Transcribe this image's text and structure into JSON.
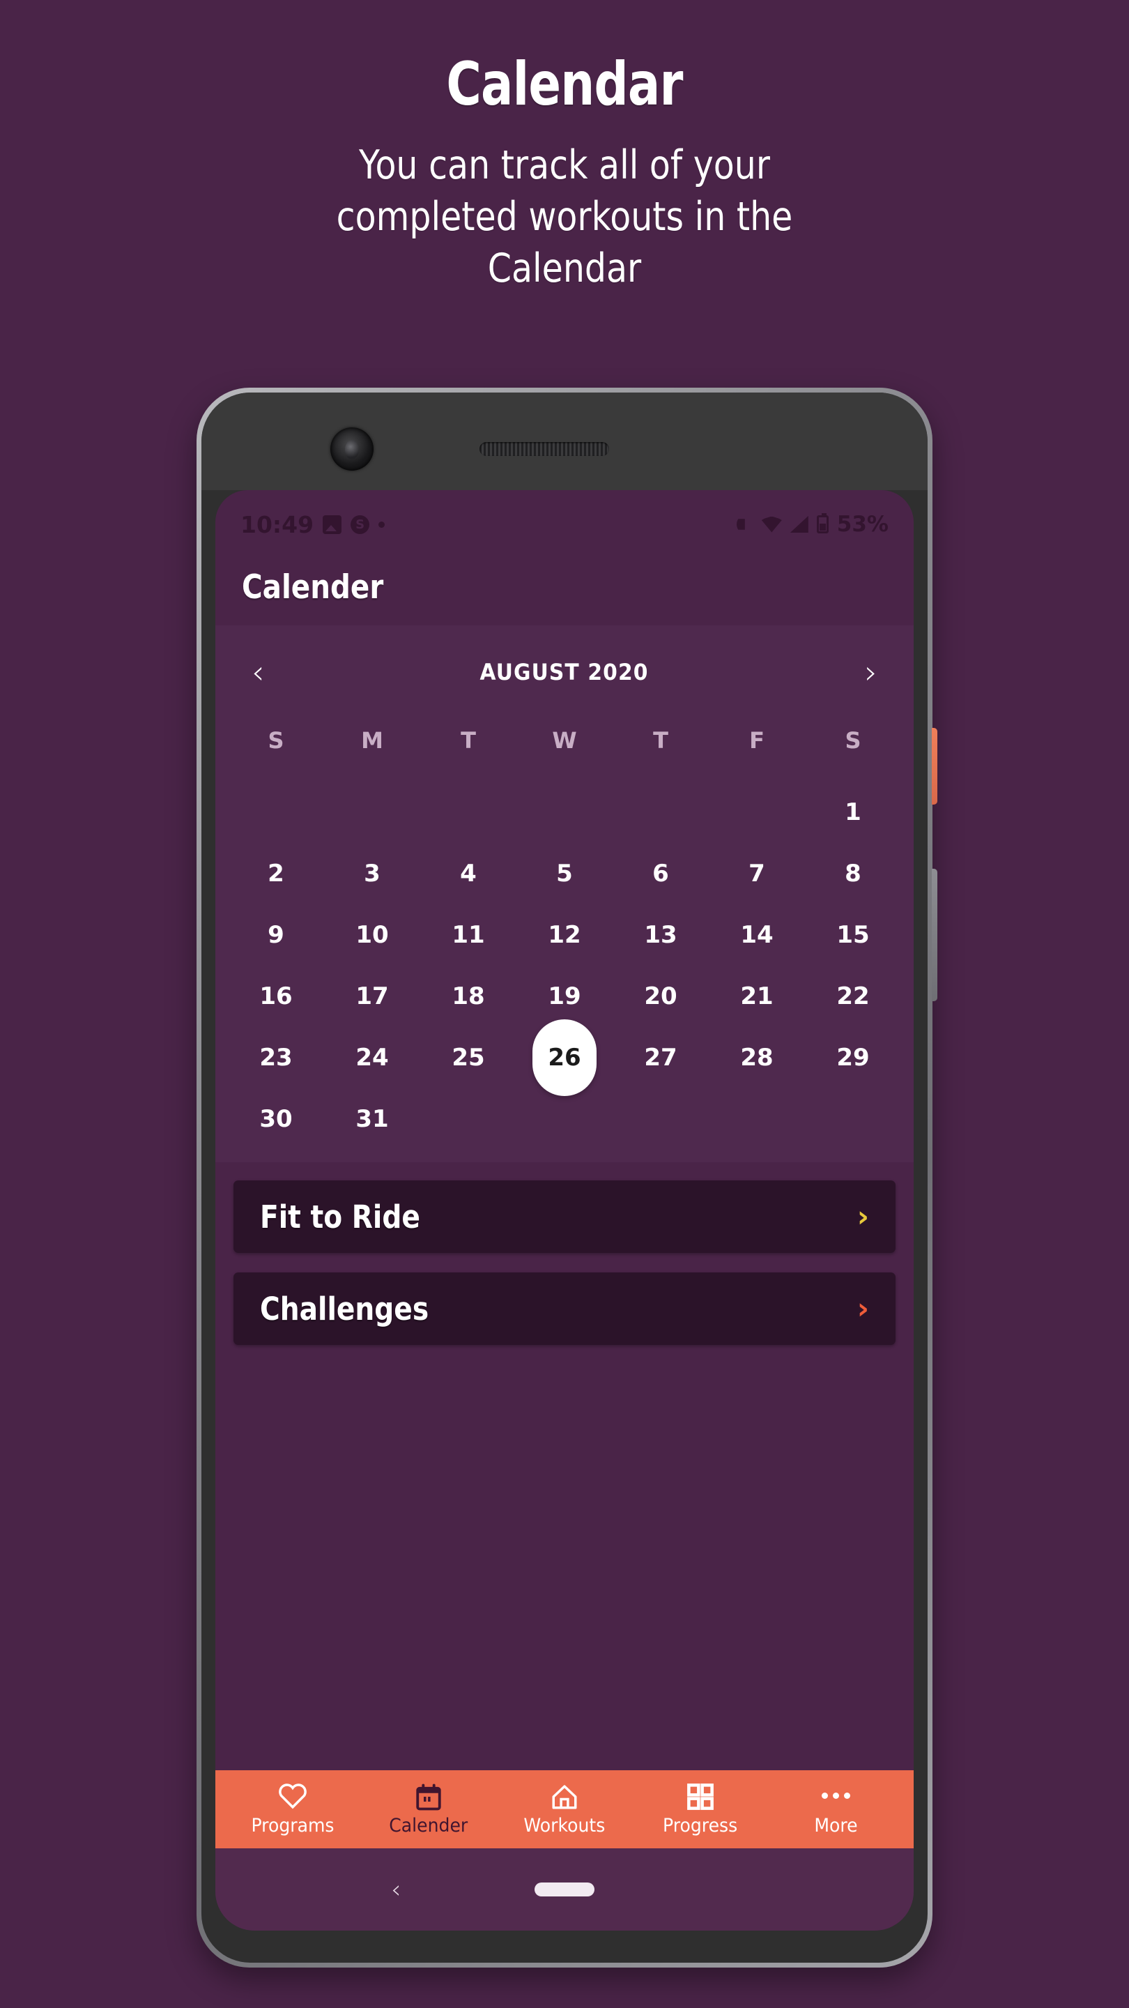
{
  "promo": {
    "title": "Calendar",
    "subtitle": "You can track all of your completed workouts in the Calendar"
  },
  "statusbar": {
    "time": "10:49",
    "battery": "53%",
    "left_icons": [
      "photo-icon",
      "s-app-icon",
      "dot-icon"
    ],
    "right_icons": [
      "vibrate-icon",
      "wifi-icon",
      "signal-icon",
      "battery-icon"
    ]
  },
  "appbar": {
    "title": "Calender"
  },
  "calendar": {
    "prev_label": "‹",
    "next_label": "›",
    "month": "AUGUST 2020",
    "weekdays": [
      "S",
      "M",
      "T",
      "W",
      "T",
      "F",
      "S"
    ],
    "selected_day": 26,
    "weeks": [
      [
        "",
        "",
        "",
        "",
        "",
        "",
        "1"
      ],
      [
        "2",
        "3",
        "4",
        "5",
        "6",
        "7",
        "8"
      ],
      [
        "9",
        "10",
        "11",
        "12",
        "13",
        "14",
        "15"
      ],
      [
        "16",
        "17",
        "18",
        "19",
        "20",
        "21",
        "22"
      ],
      [
        "23",
        "24",
        "25",
        "26",
        "27",
        "28",
        "29"
      ],
      [
        "30",
        "31",
        "",
        "",
        "",
        "",
        ""
      ]
    ]
  },
  "cards": [
    {
      "title": "Fit to Ride",
      "chevron": "›",
      "chevron_color": "#e8c93c"
    },
    {
      "title": "Challenges",
      "chevron": "›",
      "chevron_color": "#ef5d3a"
    }
  ],
  "bottomnav": {
    "accent": "#ec6a4c",
    "active_color": "#40152f",
    "items": [
      {
        "label": "Programs",
        "icon": "heart-icon",
        "active": false
      },
      {
        "label": "Calender",
        "icon": "calendar-icon",
        "active": true
      },
      {
        "label": "Workouts",
        "icon": "home-icon",
        "active": false
      },
      {
        "label": "Progress",
        "icon": "grid-icon",
        "active": false
      },
      {
        "label": "More",
        "icon": "dots-icon",
        "active": false
      }
    ]
  },
  "androidnav": {
    "back": "‹"
  },
  "colors": {
    "background": "#4a2448",
    "card": "#2b1329",
    "screen": "#4a2448"
  }
}
